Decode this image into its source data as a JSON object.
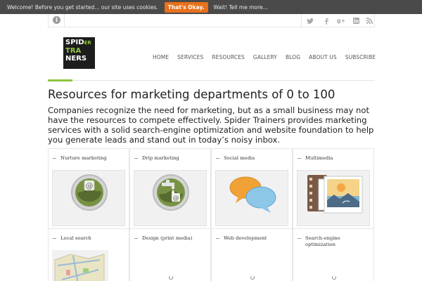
{
  "cookie": {
    "message": "Welcome! Before you get started... our site uses cookies.",
    "ok_label": "That's Okay.",
    "more_label": "Wait! Tell me more..."
  },
  "topbar": {
    "info_icon": "info-icon",
    "social": [
      "twitter-icon",
      "facebook-icon",
      "google-plus-icon",
      "linkedin-icon",
      "rss-icon"
    ]
  },
  "logo": {
    "line1": "SPID",
    "line1b": "ER",
    "line2": "TRA",
    "line2b": "NERS",
    "alt": "Spider Trainers"
  },
  "nav": [
    "HOME",
    "SERVICES",
    "RESOURCES",
    "GALLERY",
    "BLOG",
    "ABOUT US",
    "SUBSCRIBE"
  ],
  "page": {
    "title": "Resources for marketing departments of 0 to 100",
    "intro": "Companies recognize the need for marketing, but as a small business may not have the resources to compete effectively. Spider Trainers provides marketing services with a solid search-engine optimization and website foundation to help you generate leads and stand out in today’s noisy inbox."
  },
  "grid": [
    {
      "label": "Nurture marketing",
      "icon": "email-globe-icon"
    },
    {
      "label": "Drip marketing",
      "icon": "drip-faucet-icon"
    },
    {
      "label": "Social media",
      "icon": "speech-bubbles-icon"
    },
    {
      "label": "Multimedia",
      "icon": "film-photo-icon"
    },
    {
      "label": "Local search",
      "icon": "map-icon"
    },
    {
      "label": "Design (print media)",
      "icon": "loading-icon"
    },
    {
      "label": "Web development",
      "icon": "loading-icon"
    },
    {
      "label": "Search-engine optimization",
      "icon": "loading-icon"
    }
  ],
  "colors": {
    "accent_green": "#8ec63f",
    "cookie_button": "#e8711c",
    "cookie_bar": "#4a4a4a"
  }
}
